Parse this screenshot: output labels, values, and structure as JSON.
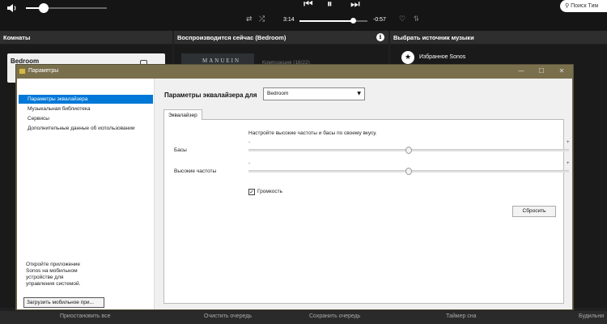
{
  "player": {
    "time_elapsed": "3:14",
    "time_remaining": "-0:57",
    "volume_level": 0.22,
    "progress_fraction": 0.78,
    "search_placeholder": "Поиск Тим",
    "prev_icon": "skip-previous-icon",
    "play_pause_icon": "pause-icon",
    "next_icon": "skip-next-icon"
  },
  "columns": {
    "rooms": "Комнаты",
    "now_playing": "Воспроизводится сейчас (Bedroom)",
    "music_source": "Выбрать источник музыки"
  },
  "rooms": {
    "room_name": "Bedroom"
  },
  "now_playing": {
    "album_art_text": "MANUEIN",
    "track_sub": "Композиция (16/22)"
  },
  "sources": {
    "favorites": "Избранное Sonos"
  },
  "bottom_bar": {
    "pause_all": "Приостановить все",
    "clear_queue": "Очистить очередь",
    "save_queue": "Сохранить очередь",
    "timer": "Таймер сна",
    "alarms": "Будильни"
  },
  "dialog": {
    "title": "Параметры",
    "nav_items": [
      "Параметры эквалайзера",
      "Музыкальная библиотека",
      "Сервисы",
      "Дополнительные данные об использовании"
    ],
    "nav_hint_lines": [
      "Откройте приложение",
      "Sonos на мобильном",
      "устройстве для",
      "управления системой."
    ],
    "get_mobile_button": "Загрузить мобильное при...",
    "eq_title": "Параметры эквалайзера для",
    "room_select_value": "Bedroom",
    "tab_label": "Эквалайзер",
    "tune_hint": "Настройте высокие частоты и басы по своему вкусу.",
    "bass_label": "Басы",
    "treble_label": "Высокие частоты",
    "slider_min": "-",
    "slider_max": "+",
    "bass_value": 0,
    "treble_value": 0,
    "loudness_label": "Громкость",
    "loudness_checked": true,
    "reset_button": "Сбросить"
  }
}
